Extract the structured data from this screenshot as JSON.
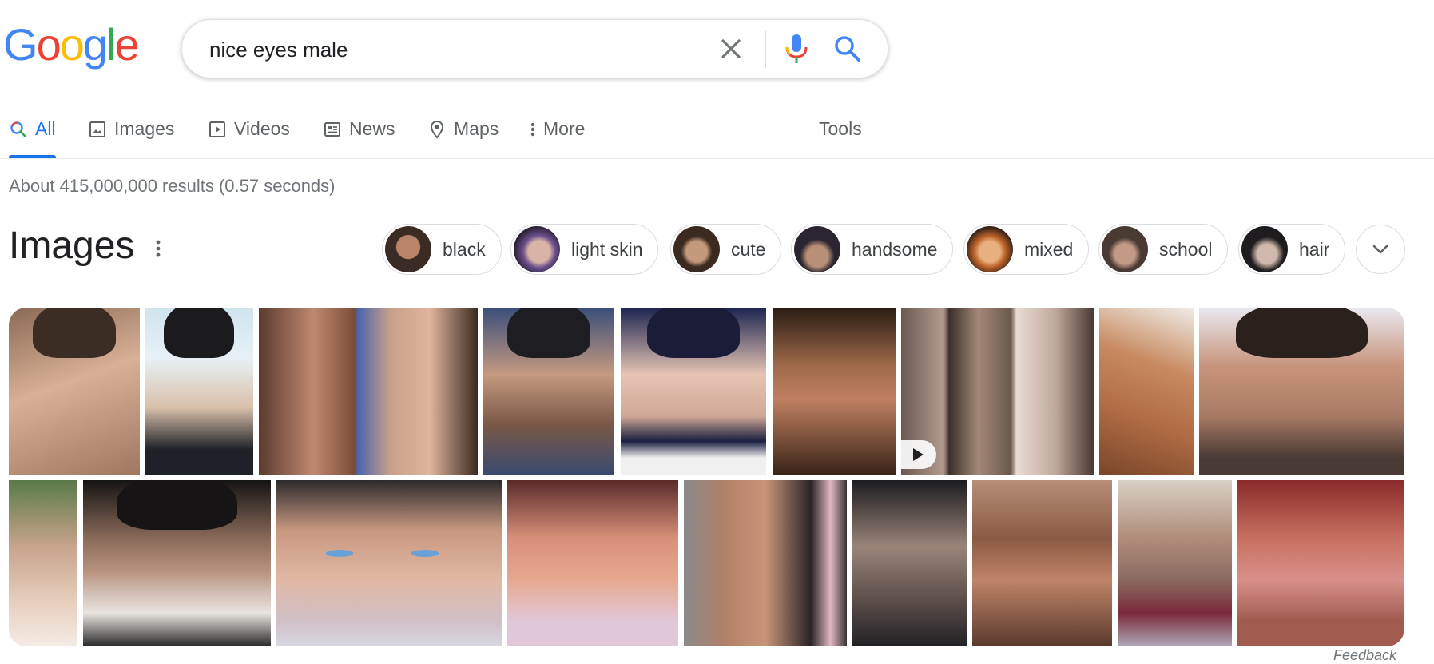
{
  "logo": {
    "letters": [
      "G",
      "o",
      "o",
      "g",
      "l",
      "e"
    ],
    "colors": [
      "#4285f4",
      "#ea4335",
      "#fbbc05",
      "#4285f4",
      "#34a853",
      "#ea4335"
    ]
  },
  "search": {
    "query": "nice eyes male",
    "clear_icon": "close-icon",
    "mic_icon": "mic-icon",
    "search_icon": "search-icon"
  },
  "tabs": [
    {
      "label": "All",
      "icon": "search-icon",
      "active": true
    },
    {
      "label": "Images",
      "icon": "image-icon"
    },
    {
      "label": "Videos",
      "icon": "play-icon"
    },
    {
      "label": "News",
      "icon": "news-icon"
    },
    {
      "label": "Maps",
      "icon": "location-pin-icon"
    },
    {
      "label": "More",
      "icon": "more-vert-icon"
    }
  ],
  "tools_label": "Tools",
  "result_stats": "About 415,000,000 results (0.57 seconds)",
  "images_section": {
    "title": "Images",
    "chips": [
      "black",
      "light skin",
      "cute",
      "handsome",
      "mixed",
      "school",
      "hair"
    ]
  },
  "feedback_label": "Feedback",
  "colors": {
    "accent": "#1a73e8",
    "text_secondary": "#70757a",
    "border": "#dadce0"
  }
}
